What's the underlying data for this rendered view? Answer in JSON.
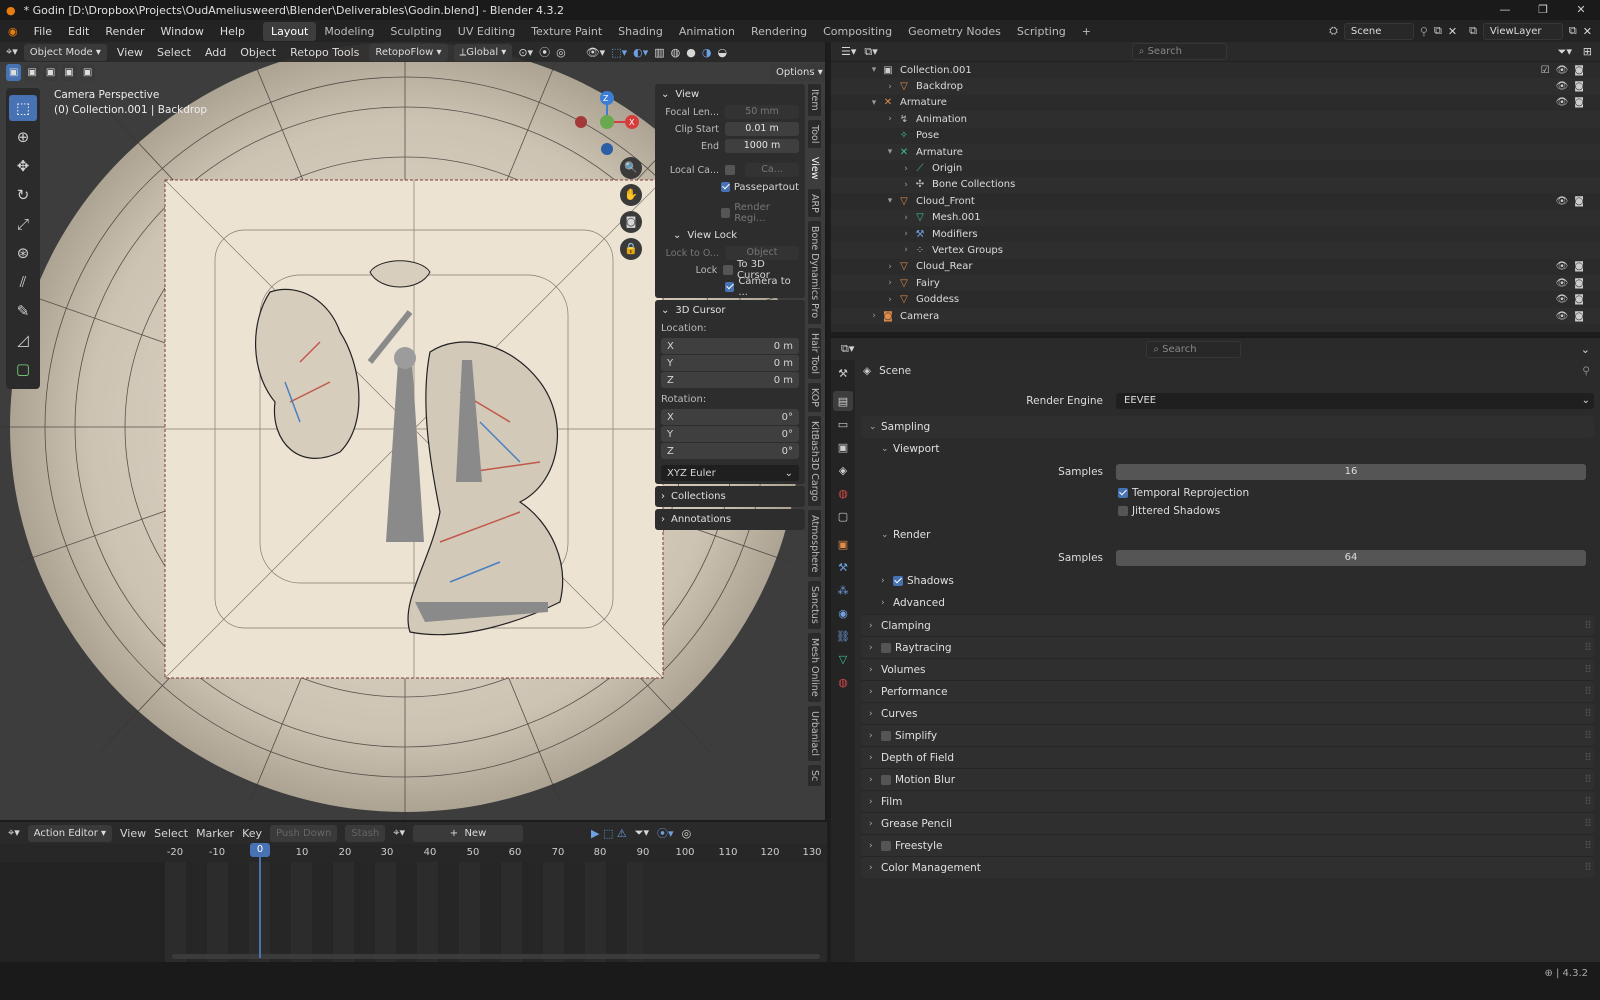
{
  "title_bar": {
    "title": "* Godin [D:\\Dropbox\\Projects\\OudAmeliusweerd\\Blender\\Deliverables\\Godin.blend] - Blender 4.3.2"
  },
  "menus": [
    "File",
    "Edit",
    "Render",
    "Window",
    "Help"
  ],
  "workspaces": [
    "Layout",
    "Modeling",
    "Sculpting",
    "UV Editing",
    "Texture Paint",
    "Shading",
    "Animation",
    "Rendering",
    "Compositing",
    "Geometry Nodes",
    "Scripting"
  ],
  "active_workspace": "Layout",
  "scene": {
    "name": "Scene",
    "view_layer": "ViewLayer"
  },
  "viewport": {
    "mode": "Object Mode",
    "menus": [
      "View",
      "Select",
      "Add",
      "Object",
      "Retopo Tools"
    ],
    "addon_dropdown": "RetopoFlow",
    "transform_orientation": "Global",
    "options_label": "Options",
    "overlay_line1": "Camera Perspective",
    "overlay_line2": "(0) Collection.001 | Backdrop",
    "gizmo": {
      "z": "Z",
      "x": "X"
    }
  },
  "npanel": {
    "view_header": "View",
    "focal_label": "Focal Len...",
    "focal_value": "50 mm",
    "clip_start_label": "Clip Start",
    "clip_start_value": "0.01 m",
    "end_label": "End",
    "end_value": "1000 m",
    "local_camera_label": "Local Ca...",
    "local_camera_value": "Ca...",
    "passepartout": "Passepartout",
    "render_region": "Render Regi...",
    "view_lock_header": "View Lock",
    "lock_to_label": "Lock to O...",
    "lock_to_value": "Object",
    "lock_label": "Lock",
    "to_cursor": "To 3D Cursor",
    "camera_to": "Camera to ...",
    "cursor_header": "3D Cursor",
    "location_label": "Location:",
    "loc": [
      {
        "axis": "X",
        "value": "0 m"
      },
      {
        "axis": "Y",
        "value": "0 m"
      },
      {
        "axis": "Z",
        "value": "0 m"
      }
    ],
    "rotation_label": "Rotation:",
    "rot": [
      {
        "axis": "X",
        "value": "0°"
      },
      {
        "axis": "Y",
        "value": "0°"
      },
      {
        "axis": "Z",
        "value": "0°"
      }
    ],
    "rotation_mode": "XYZ Euler",
    "collections_header": "Collections",
    "annotations_header": "Annotations"
  },
  "side_tabs": [
    "Item",
    "Tool",
    "View",
    "ARP",
    "Bone Dynamics Pro",
    "Hair Tool",
    "KOP",
    "KitBash3D Cargo",
    "Atmosphere",
    "Sanctus",
    "Mesh Online",
    "Urbaniacl",
    "Sc"
  ],
  "action_editor": {
    "editor": "Action Editor",
    "menus": [
      "View",
      "Select",
      "Marker",
      "Key"
    ],
    "push_down": "Push Down",
    "stash": "Stash",
    "new": "New",
    "ruler": [
      "-20",
      "-10",
      "0",
      "10",
      "20",
      "30",
      "40",
      "50",
      "60",
      "70",
      "80",
      "90",
      "100",
      "110",
      "120",
      "130"
    ],
    "current_frame": "0"
  },
  "outliner": {
    "search_placeholder": "Search",
    "rows": [
      {
        "name": "Collection.001",
        "indent": 1,
        "icon": "collection-icon",
        "glyph": "▣",
        "color": "#cccccc",
        "arrow": "▾"
      },
      {
        "name": "Backdrop",
        "indent": 2,
        "icon": "mesh-object-icon",
        "glyph": "▽",
        "color": "#e08c4a",
        "arrow": "›"
      },
      {
        "name": "Armature",
        "indent": 1,
        "icon": "armature-icon",
        "glyph": "✕",
        "color": "#e08c4a",
        "arrow": "▾"
      },
      {
        "name": "Animation",
        "indent": 2,
        "icon": "animation-icon",
        "glyph": "↯",
        "color": "#bbbbbb",
        "arrow": "›"
      },
      {
        "name": "Pose",
        "indent": 2,
        "icon": "pose-icon",
        "glyph": "✧",
        "color": "#3fbf9f",
        "arrow": ""
      },
      {
        "name": "Armature",
        "indent": 2,
        "icon": "armature-data-icon",
        "glyph": "✕",
        "color": "#3fbf9f",
        "arrow": "▾"
      },
      {
        "name": "Origin",
        "indent": 3,
        "icon": "bone-icon",
        "glyph": "⟋",
        "color": "#3fbf9f",
        "arrow": "›"
      },
      {
        "name": "Bone Collections",
        "indent": 3,
        "icon": "bone-collections-icon",
        "glyph": "✣",
        "color": "#bbbbbb",
        "arrow": "›"
      },
      {
        "name": "Cloud_Front",
        "indent": 2,
        "icon": "mesh-object-icon",
        "glyph": "▽",
        "color": "#e08c4a",
        "arrow": "▾"
      },
      {
        "name": "Mesh.001",
        "indent": 3,
        "icon": "mesh-data-icon",
        "glyph": "▽",
        "color": "#3fbf9f",
        "arrow": "›"
      },
      {
        "name": "Modifiers",
        "indent": 3,
        "icon": "wrench-icon",
        "glyph": "⚒",
        "color": "#6f9fdf",
        "arrow": "›"
      },
      {
        "name": "Vertex Groups",
        "indent": 3,
        "icon": "vertex-groups-icon",
        "glyph": "⁘",
        "color": "#bbbbbb",
        "arrow": "›"
      },
      {
        "name": "Cloud_Rear",
        "indent": 2,
        "icon": "mesh-object-icon",
        "glyph": "▽",
        "color": "#e08c4a",
        "arrow": "›"
      },
      {
        "name": "Fairy",
        "indent": 2,
        "icon": "mesh-object-icon",
        "glyph": "▽",
        "color": "#e08c4a",
        "arrow": "›"
      },
      {
        "name": "Goddess",
        "indent": 2,
        "icon": "mesh-object-icon",
        "glyph": "▽",
        "color": "#e08c4a",
        "arrow": "›"
      },
      {
        "name": "Camera",
        "indent": 1,
        "icon": "camera-object-icon",
        "glyph": "◙",
        "color": "#e08c4a",
        "arrow": "›"
      }
    ]
  },
  "properties": {
    "search_placeholder": "Search",
    "context": "Scene",
    "render_engine_label": "Render Engine",
    "render_engine": "EEVEE",
    "sampling": "Sampling",
    "viewport": "Viewport",
    "samples_label": "Samples",
    "viewport_samples": "16",
    "temporal": "Temporal Reprojection",
    "jittered": "Jittered Shadows",
    "render": "Render",
    "render_samples": "64",
    "shadows": "Shadows",
    "advanced": "Advanced",
    "sections": [
      "Clamping",
      "Raytracing",
      "Volumes",
      "Performance",
      "Curves",
      "Simplify",
      "Depth of Field",
      "Motion Blur",
      "Film",
      "Grease Pencil",
      "Freestyle",
      "Color Management"
    ]
  },
  "status": {
    "version": "4.3.2"
  }
}
